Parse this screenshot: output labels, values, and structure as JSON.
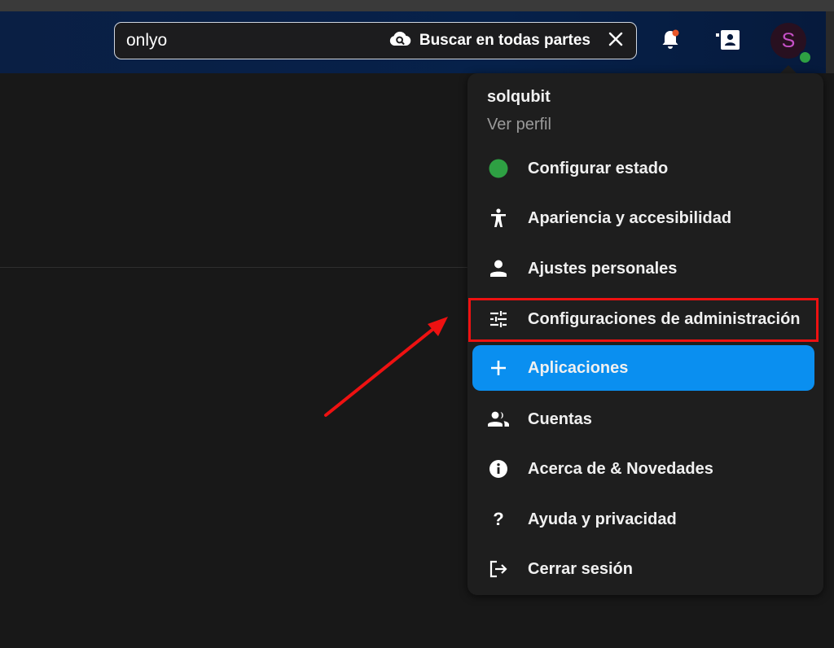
{
  "search": {
    "value": "onlyo",
    "scope_label": "Buscar en todas partes"
  },
  "header": {
    "icons": [
      "cloud-search-icon",
      "close-icon",
      "bell-icon",
      "contacts-icon"
    ],
    "avatar_letter": "S",
    "notification_dot_color": "#e8582a",
    "status_color": "#2ea043"
  },
  "user_menu": {
    "user_name": "solqubit",
    "view_profile": "Ver perfil",
    "items": [
      {
        "label": "Configurar estado",
        "icon": "status-dot-icon"
      },
      {
        "label": "Apariencia y accesibilidad",
        "icon": "accessibility-icon"
      },
      {
        "label": "Ajustes personales",
        "icon": "person-icon"
      },
      {
        "label": "Configuraciones de administración",
        "icon": "tune-icon",
        "highlighted": true
      },
      {
        "label": "Aplicaciones",
        "icon": "plus-icon",
        "active": true
      },
      {
        "label": "Cuentas",
        "icon": "accounts-icon"
      },
      {
        "label": "Acerca de & Novedades",
        "icon": "info-icon"
      },
      {
        "label": "Ayuda y privacidad",
        "icon": "help-icon"
      },
      {
        "label": "Cerrar sesión",
        "icon": "logout-icon"
      }
    ]
  },
  "colors": {
    "accent": "#0a8ff0",
    "highlight_border": "#ee1111",
    "annotation_arrow": "#ee1111",
    "menu_bg": "#1e1e1e",
    "page_bg": "#181818"
  }
}
